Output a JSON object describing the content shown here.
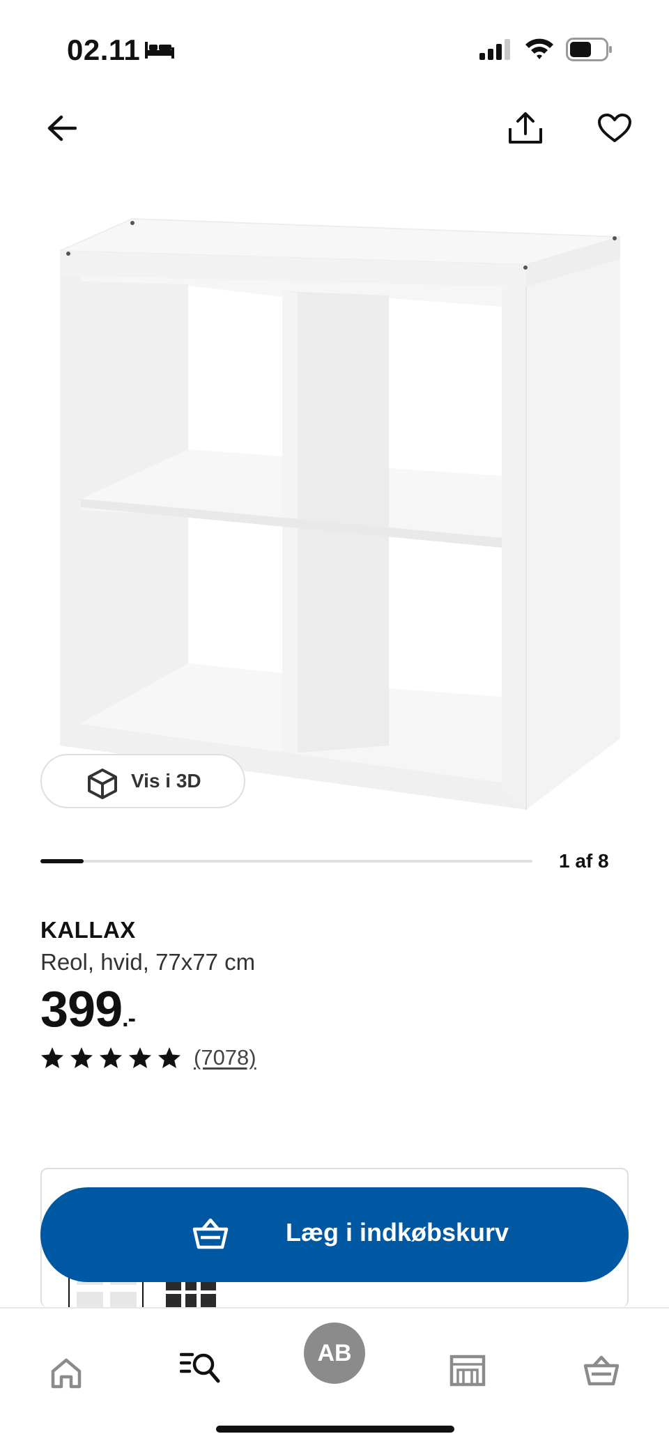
{
  "status_bar": {
    "time": "02.11",
    "bed_icon": "bed-icon",
    "signal_icon": "cellular-signal-icon",
    "wifi_icon": "wifi-icon",
    "battery_icon": "battery-icon"
  },
  "nav": {
    "back_icon": "arrow-left-icon",
    "share_icon": "share-icon",
    "favorite_icon": "heart-icon"
  },
  "gallery": {
    "view_3d_label": "Vis i 3D",
    "view_3d_icon": "cube-icon",
    "page_indicator": "1 af 8",
    "current_page": 1,
    "total_pages": 8
  },
  "product": {
    "name": "KALLAX",
    "description": "Reol, hvid, 77x77 cm",
    "price": "399",
    "price_suffix": ".-",
    "rating": 5,
    "review_count": "(7078)"
  },
  "cart_button": {
    "label": "Læg i indkøbskurv",
    "icon": "shopping-basket-icon",
    "color": "#0058a3"
  },
  "tab_bar": {
    "home_icon": "home-icon",
    "search_icon": "search-list-icon",
    "profile_initials": "AB",
    "store_icon": "store-icon",
    "cart_icon": "shopping-basket-icon"
  },
  "colors": {
    "accent": "#0058a3",
    "text": "#111111",
    "muted": "#8b8b8b"
  }
}
